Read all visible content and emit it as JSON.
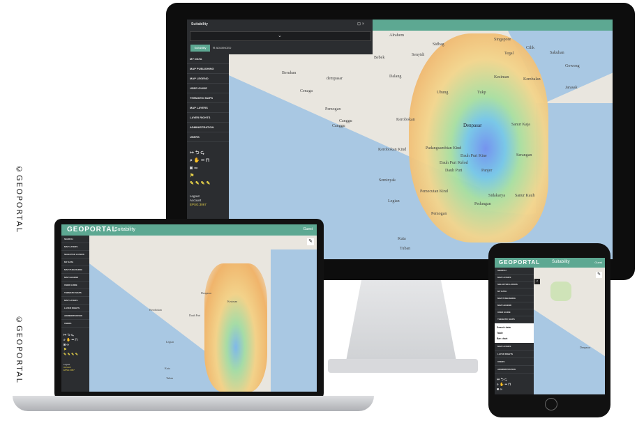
{
  "side_text_top": "©GEOPORTAL",
  "side_text_bottom": "©GEOPORTAL",
  "monitor": {
    "panel_title": "Suitability",
    "btn_suitability": "Suitability",
    "btn_advanced": "ADVANCED",
    "menu": [
      "MY DATA",
      "MAP PUBLISHING",
      "MAP LEGEND",
      "USER GUIDE",
      "THEMATIC MAPS",
      "MAP LAYERS",
      "LAYER RIGHTS",
      "ADMINISTRATION",
      "USERS"
    ],
    "tools_row1": [
      "↦",
      "⮌",
      "⮎"
    ],
    "tools_row2": [
      "🔍",
      "✋",
      "━",
      "⊢"
    ],
    "tools_row3": [
      "📷",
      "🔗"
    ],
    "logout": "Logout",
    "account": "Account",
    "epsg": "EPSG:3067",
    "places": {
      "abrahem": "Alrahem",
      "sidbag": "Sidbag",
      "singapore": "Singapore",
      "cilik": "Cilik",
      "sakuhan": "Sakuhan",
      "tegal": "Tegal",
      "bebek": "Bebek",
      "senyidi": "Senyidi",
      "gowong": "Gowong",
      "jarasak": "Jarasak",
      "beruban": "Beruban",
      "dekpasar": "dempasar",
      "dalang": "Dalang",
      "kesiman": "Kesiman",
      "kembalan": "Kembalan",
      "cenaga": "Cenaga",
      "ubung": "Ubung",
      "tukp": "Tukp",
      "kembalan2": "Kembalan",
      "pemogan": "Pemogan",
      "canggu": "Canggu",
      "canggu2": "Canggu",
      "kerobokan": "Kerobokan",
      "denpasar": "Denpasar",
      "sanur": "Sanur Kaja",
      "kerobokan_kind": "Kerobokan Kind",
      "padangsambian": "Padangsambian Kind",
      "dauh_puri": "Dauh Puri Kine",
      "dauh_puri_kelod": "Dauh Puri Kelod",
      "dauh_puri2": "Dauh Puri",
      "panjer": "Panjer",
      "seminyak": "Seminyak",
      "legian": "Legian",
      "pedungan": "Pedungan",
      "sidakarya": "Sidakarya",
      "pemecutan": "Pemecutan Kind",
      "sanur_kauh": "Sanur Kauh",
      "serangan": "Serangan",
      "kuta": "Kuta",
      "tuban": "Tuban",
      "pemogan2": "Pemogan"
    }
  },
  "laptop": {
    "brand": "GEOPORTAL",
    "app": "Suitability",
    "user": "Guest",
    "menu": [
      "SEARCH",
      "MAP LAYERS",
      "SELECTED LAYERS",
      "MY DATA",
      "MAP PUBLISHING",
      "MAP LEGEND",
      "USER GUIDE",
      "THEMATIC MAPS",
      "MAP LAYERS",
      "LAYER RIGHTS",
      "ADMINISTRATION",
      "USERS"
    ],
    "logout": "Logout",
    "account": "Account",
    "epsg": "EPSG:3067",
    "places": {
      "denpasar": "Denpasar",
      "kuta": "Kuta",
      "tuban": "Tuban",
      "dauh": "Dauh Puri",
      "kesiman": "Kesiman",
      "kerobokan": "Kerobokan",
      "legian": "Legian"
    }
  },
  "tablet": {
    "brand": "GEOPORTAL",
    "app": "Suitability",
    "user": "Guest",
    "menu_top": [
      "SEARCH",
      "MAP LAYERS",
      "SELECTED LAYERS",
      "MY DATA",
      "MAP PUBLISHING",
      "MAP LEGEND",
      "USER GUIDE",
      "THEMATIC MAPS"
    ],
    "thematic": [
      "Search data",
      "Table",
      "Bar chart"
    ],
    "menu_bottom": [
      "MAP LAYERS",
      "LAYER RIGHTS",
      "USERS",
      "ADMINISTRATION"
    ],
    "places": {
      "denpasar": "Denpasar"
    }
  },
  "colors": {
    "accent": "#5da892",
    "sidebar": "#2b2d30",
    "sea": "#a9c8e3",
    "land": "#e9e6df",
    "highlight": "#e8d34a"
  }
}
